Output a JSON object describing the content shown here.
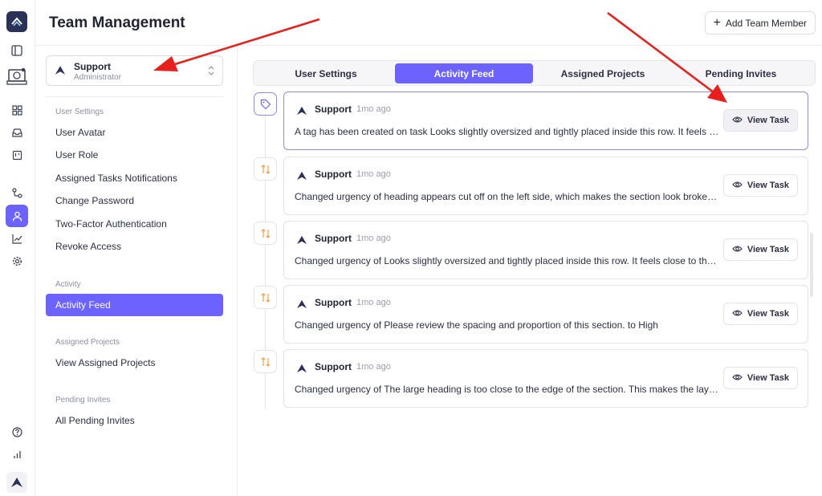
{
  "header": {
    "title": "Team Management",
    "add_member_label": "Add Team Member"
  },
  "workspace": {
    "name": "Support",
    "role": "Administrator"
  },
  "sidebar": {
    "sections": [
      {
        "label": "User Settings",
        "items": [
          "User Avatar",
          "User Role",
          "Assigned Tasks Notifications",
          "Change Password",
          "Two-Factor Authentication",
          "Revoke Access"
        ]
      },
      {
        "label": "Activity",
        "items": [
          "Activity Feed"
        ]
      },
      {
        "label": "Assigned Projects",
        "items": [
          "View Assigned Projects"
        ]
      },
      {
        "label": "Pending Invites",
        "items": [
          "All Pending Invites"
        ]
      }
    ],
    "active_item": "Activity Feed"
  },
  "tabs": [
    "User Settings",
    "Activity Feed",
    "Assigned Projects",
    "Pending Invites"
  ],
  "active_tab": "Activity Feed",
  "feed": [
    {
      "icon": "tag-icon",
      "author": "Support",
      "time": "1mo ago",
      "text": "A tag has been created on task Looks slightly oversized and tightly placed inside this row. It feels close to the edges.",
      "button": "View Task"
    },
    {
      "icon": "swap-vertical-icon",
      "author": "Support",
      "time": "1mo ago",
      "text": "Changed urgency of heading appears cut off on the left side, which makes the section look broken. to High",
      "button": "View Task"
    },
    {
      "icon": "swap-vertical-icon",
      "author": "Support",
      "time": "1mo ago",
      "text": "Changed urgency of Looks slightly oversized and tightly placed inside this row. It feels close to the edges. to High",
      "button": "View Task"
    },
    {
      "icon": "swap-vertical-icon",
      "author": "Support",
      "time": "1mo ago",
      "text": "Changed urgency of Please review the spacing and proportion of this section. to High",
      "button": "View Task"
    },
    {
      "icon": "swap-vertical-icon",
      "author": "Support",
      "time": "1mo ago",
      "text": "Changed urgency of The large heading is too close to the edge of the section. This makes the layout feel cramped. to High",
      "button": "View Task"
    }
  ],
  "colors": {
    "accent": "#6c63ff",
    "annotation_arrow": "#e8201c",
    "brand_dark": "#2b3257"
  }
}
